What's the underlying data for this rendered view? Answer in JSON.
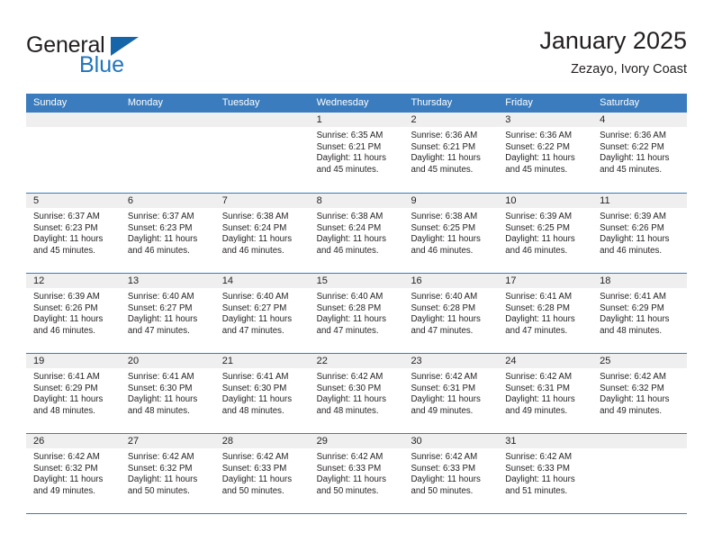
{
  "brand": {
    "name_top": "General",
    "name_bottom": "Blue",
    "accent_color": "#2175bd",
    "triangle_color": "#1565a8"
  },
  "header": {
    "title": "January 2025",
    "subtitle": "Zezayo, Ivory Coast"
  },
  "calendar": {
    "header_bg": "#3a7cbe",
    "daynum_bg": "#efefef",
    "weekday_names": [
      "Sunday",
      "Monday",
      "Tuesday",
      "Wednesday",
      "Thursday",
      "Friday",
      "Saturday"
    ],
    "weeks": [
      [
        {
          "day": "",
          "sunrise": "",
          "sunset": "",
          "daylight": "",
          "empty": true
        },
        {
          "day": "",
          "sunrise": "",
          "sunset": "",
          "daylight": "",
          "empty": true
        },
        {
          "day": "",
          "sunrise": "",
          "sunset": "",
          "daylight": "",
          "empty": true
        },
        {
          "day": "1",
          "sunrise": "Sunrise: 6:35 AM",
          "sunset": "Sunset: 6:21 PM",
          "daylight": "Daylight: 11 hours and 45 minutes."
        },
        {
          "day": "2",
          "sunrise": "Sunrise: 6:36 AM",
          "sunset": "Sunset: 6:21 PM",
          "daylight": "Daylight: 11 hours and 45 minutes."
        },
        {
          "day": "3",
          "sunrise": "Sunrise: 6:36 AM",
          "sunset": "Sunset: 6:22 PM",
          "daylight": "Daylight: 11 hours and 45 minutes."
        },
        {
          "day": "4",
          "sunrise": "Sunrise: 6:36 AM",
          "sunset": "Sunset: 6:22 PM",
          "daylight": "Daylight: 11 hours and 45 minutes."
        }
      ],
      [
        {
          "day": "5",
          "sunrise": "Sunrise: 6:37 AM",
          "sunset": "Sunset: 6:23 PM",
          "daylight": "Daylight: 11 hours and 45 minutes."
        },
        {
          "day": "6",
          "sunrise": "Sunrise: 6:37 AM",
          "sunset": "Sunset: 6:23 PM",
          "daylight": "Daylight: 11 hours and 46 minutes."
        },
        {
          "day": "7",
          "sunrise": "Sunrise: 6:38 AM",
          "sunset": "Sunset: 6:24 PM",
          "daylight": "Daylight: 11 hours and 46 minutes."
        },
        {
          "day": "8",
          "sunrise": "Sunrise: 6:38 AM",
          "sunset": "Sunset: 6:24 PM",
          "daylight": "Daylight: 11 hours and 46 minutes."
        },
        {
          "day": "9",
          "sunrise": "Sunrise: 6:38 AM",
          "sunset": "Sunset: 6:25 PM",
          "daylight": "Daylight: 11 hours and 46 minutes."
        },
        {
          "day": "10",
          "sunrise": "Sunrise: 6:39 AM",
          "sunset": "Sunset: 6:25 PM",
          "daylight": "Daylight: 11 hours and 46 minutes."
        },
        {
          "day": "11",
          "sunrise": "Sunrise: 6:39 AM",
          "sunset": "Sunset: 6:26 PM",
          "daylight": "Daylight: 11 hours and 46 minutes."
        }
      ],
      [
        {
          "day": "12",
          "sunrise": "Sunrise: 6:39 AM",
          "sunset": "Sunset: 6:26 PM",
          "daylight": "Daylight: 11 hours and 46 minutes."
        },
        {
          "day": "13",
          "sunrise": "Sunrise: 6:40 AM",
          "sunset": "Sunset: 6:27 PM",
          "daylight": "Daylight: 11 hours and 47 minutes."
        },
        {
          "day": "14",
          "sunrise": "Sunrise: 6:40 AM",
          "sunset": "Sunset: 6:27 PM",
          "daylight": "Daylight: 11 hours and 47 minutes."
        },
        {
          "day": "15",
          "sunrise": "Sunrise: 6:40 AM",
          "sunset": "Sunset: 6:28 PM",
          "daylight": "Daylight: 11 hours and 47 minutes."
        },
        {
          "day": "16",
          "sunrise": "Sunrise: 6:40 AM",
          "sunset": "Sunset: 6:28 PM",
          "daylight": "Daylight: 11 hours and 47 minutes."
        },
        {
          "day": "17",
          "sunrise": "Sunrise: 6:41 AM",
          "sunset": "Sunset: 6:28 PM",
          "daylight": "Daylight: 11 hours and 47 minutes."
        },
        {
          "day": "18",
          "sunrise": "Sunrise: 6:41 AM",
          "sunset": "Sunset: 6:29 PM",
          "daylight": "Daylight: 11 hours and 48 minutes."
        }
      ],
      [
        {
          "day": "19",
          "sunrise": "Sunrise: 6:41 AM",
          "sunset": "Sunset: 6:29 PM",
          "daylight": "Daylight: 11 hours and 48 minutes."
        },
        {
          "day": "20",
          "sunrise": "Sunrise: 6:41 AM",
          "sunset": "Sunset: 6:30 PM",
          "daylight": "Daylight: 11 hours and 48 minutes."
        },
        {
          "day": "21",
          "sunrise": "Sunrise: 6:41 AM",
          "sunset": "Sunset: 6:30 PM",
          "daylight": "Daylight: 11 hours and 48 minutes."
        },
        {
          "day": "22",
          "sunrise": "Sunrise: 6:42 AM",
          "sunset": "Sunset: 6:30 PM",
          "daylight": "Daylight: 11 hours and 48 minutes."
        },
        {
          "day": "23",
          "sunrise": "Sunrise: 6:42 AM",
          "sunset": "Sunset: 6:31 PM",
          "daylight": "Daylight: 11 hours and 49 minutes."
        },
        {
          "day": "24",
          "sunrise": "Sunrise: 6:42 AM",
          "sunset": "Sunset: 6:31 PM",
          "daylight": "Daylight: 11 hours and 49 minutes."
        },
        {
          "day": "25",
          "sunrise": "Sunrise: 6:42 AM",
          "sunset": "Sunset: 6:32 PM",
          "daylight": "Daylight: 11 hours and 49 minutes."
        }
      ],
      [
        {
          "day": "26",
          "sunrise": "Sunrise: 6:42 AM",
          "sunset": "Sunset: 6:32 PM",
          "daylight": "Daylight: 11 hours and 49 minutes."
        },
        {
          "day": "27",
          "sunrise": "Sunrise: 6:42 AM",
          "sunset": "Sunset: 6:32 PM",
          "daylight": "Daylight: 11 hours and 50 minutes."
        },
        {
          "day": "28",
          "sunrise": "Sunrise: 6:42 AM",
          "sunset": "Sunset: 6:33 PM",
          "daylight": "Daylight: 11 hours and 50 minutes."
        },
        {
          "day": "29",
          "sunrise": "Sunrise: 6:42 AM",
          "sunset": "Sunset: 6:33 PM",
          "daylight": "Daylight: 11 hours and 50 minutes."
        },
        {
          "day": "30",
          "sunrise": "Sunrise: 6:42 AM",
          "sunset": "Sunset: 6:33 PM",
          "daylight": "Daylight: 11 hours and 50 minutes."
        },
        {
          "day": "31",
          "sunrise": "Sunrise: 6:42 AM",
          "sunset": "Sunset: 6:33 PM",
          "daylight": "Daylight: 11 hours and 51 minutes."
        },
        {
          "day": "",
          "sunrise": "",
          "sunset": "",
          "daylight": "",
          "empty": true
        }
      ]
    ]
  }
}
